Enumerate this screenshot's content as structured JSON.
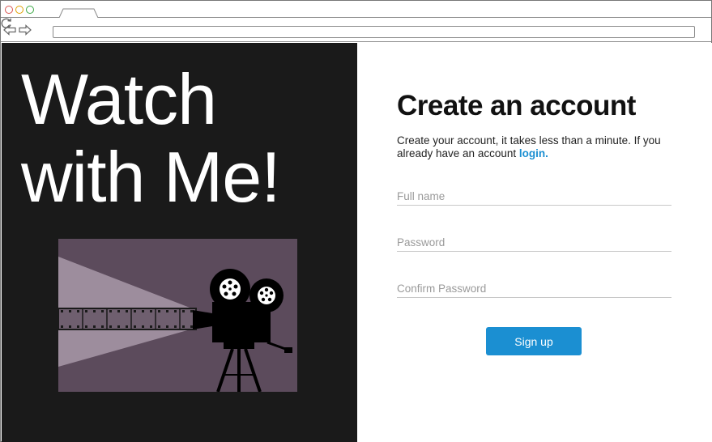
{
  "left": {
    "headline_line1": "Watch",
    "headline_line2": "with Me!"
  },
  "form": {
    "title": "Create an account",
    "description": "Create your account, it takes less than a minute. If you already have an account",
    "login_link": "login.",
    "fields": {
      "full_name": {
        "placeholder": "Full name",
        "value": ""
      },
      "password": {
        "placeholder": "Password",
        "value": ""
      },
      "confirm_password": {
        "placeholder": "Confirm Password",
        "value": ""
      }
    },
    "signup_label": "Sign up"
  },
  "colors": {
    "accent": "#1b8fd2",
    "left_bg": "#1a1a1a",
    "illustration_bg": "#5c4b5c"
  }
}
